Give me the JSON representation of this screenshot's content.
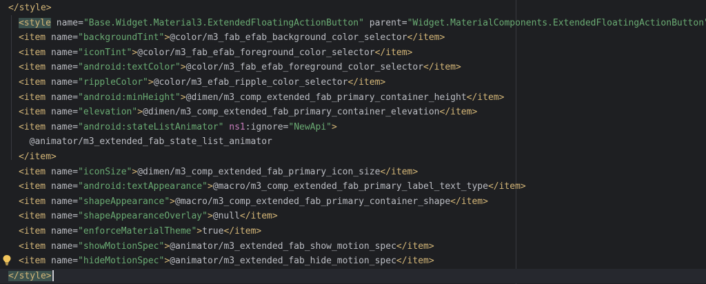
{
  "editor": {
    "lines": [
      {
        "id": "style-close-top",
        "segments": [
          {
            "cls": "tag",
            "text": "</style>"
          }
        ]
      },
      {
        "id": "style-open",
        "segments": [
          {
            "cls": "tag hl",
            "text": "<style"
          },
          {
            "cls": "attr",
            "text": " name="
          },
          {
            "cls": "str",
            "text": "\"Base.Widget.Material3.ExtendedFloatingActionButton\""
          },
          {
            "cls": "attr",
            "text": " parent="
          },
          {
            "cls": "str",
            "text": "\"Widget.MaterialComponents.ExtendedFloatingActionButton\""
          },
          {
            "cls": "tag",
            "text": ">"
          }
        ]
      },
      {
        "id": "item-backgroundTint",
        "segments": [
          {
            "cls": "tag",
            "text": "<item"
          },
          {
            "cls": "attr",
            "text": " name="
          },
          {
            "cls": "str",
            "text": "\"backgroundTint\""
          },
          {
            "cls": "tag",
            "text": ">"
          },
          {
            "cls": "txt",
            "text": "@color/m3_fab_efab_background_color_selector"
          },
          {
            "cls": "tag",
            "text": "</item>"
          }
        ]
      },
      {
        "id": "item-iconTint",
        "segments": [
          {
            "cls": "tag",
            "text": "<item"
          },
          {
            "cls": "attr",
            "text": " name="
          },
          {
            "cls": "str",
            "text": "\"iconTint\""
          },
          {
            "cls": "tag",
            "text": ">"
          },
          {
            "cls": "txt",
            "text": "@color/m3_fab_efab_foreground_color_selector"
          },
          {
            "cls": "tag",
            "text": "</item>"
          }
        ]
      },
      {
        "id": "item-textColor",
        "segments": [
          {
            "cls": "tag",
            "text": "<item"
          },
          {
            "cls": "attr",
            "text": " name="
          },
          {
            "cls": "str",
            "text": "\"android:textColor\""
          },
          {
            "cls": "tag",
            "text": ">"
          },
          {
            "cls": "txt",
            "text": "@color/m3_fab_efab_foreground_color_selector"
          },
          {
            "cls": "tag",
            "text": "</item>"
          }
        ]
      },
      {
        "id": "item-rippleColor",
        "segments": [
          {
            "cls": "tag",
            "text": "<item"
          },
          {
            "cls": "attr",
            "text": " name="
          },
          {
            "cls": "str",
            "text": "\"rippleColor\""
          },
          {
            "cls": "tag",
            "text": ">"
          },
          {
            "cls": "txt",
            "text": "@color/m3_efab_ripple_color_selector"
          },
          {
            "cls": "tag",
            "text": "</item>"
          }
        ]
      },
      {
        "id": "item-minHeight",
        "segments": [
          {
            "cls": "tag",
            "text": "<item"
          },
          {
            "cls": "attr",
            "text": " name="
          },
          {
            "cls": "str",
            "text": "\"android:minHeight\""
          },
          {
            "cls": "tag",
            "text": ">"
          },
          {
            "cls": "txt",
            "text": "@dimen/m3_comp_extended_fab_primary_container_height"
          },
          {
            "cls": "tag",
            "text": "</item>"
          }
        ]
      },
      {
        "id": "item-elevation",
        "segments": [
          {
            "cls": "tag",
            "text": "<item"
          },
          {
            "cls": "attr",
            "text": " name="
          },
          {
            "cls": "str",
            "text": "\"elevation\""
          },
          {
            "cls": "tag",
            "text": ">"
          },
          {
            "cls": "txt",
            "text": "@dimen/m3_comp_extended_fab_primary_container_elevation"
          },
          {
            "cls": "tag",
            "text": "</item>"
          }
        ]
      },
      {
        "id": "item-stateListAnimator",
        "segments": [
          {
            "cls": "tag",
            "text": "<item"
          },
          {
            "cls": "attr",
            "text": " name="
          },
          {
            "cls": "str",
            "text": "\"android:stateListAnimator\""
          },
          {
            "cls": "ns",
            "text": " ns1"
          },
          {
            "cls": "attr",
            "text": ":ignore="
          },
          {
            "cls": "str",
            "text": "\"NewApi\""
          },
          {
            "cls": "tag",
            "text": ">"
          }
        ]
      },
      {
        "id": "animator-value",
        "segments": [
          {
            "cls": "txt",
            "text": "  @animator/m3_extended_fab_state_list_animator"
          }
        ]
      },
      {
        "id": "item-close",
        "segments": [
          {
            "cls": "tag",
            "text": "</item>"
          }
        ]
      },
      {
        "id": "item-iconSize",
        "segments": [
          {
            "cls": "tag",
            "text": "<item"
          },
          {
            "cls": "attr",
            "text": " name="
          },
          {
            "cls": "str",
            "text": "\"iconSize\""
          },
          {
            "cls": "tag",
            "text": ">"
          },
          {
            "cls": "txt",
            "text": "@dimen/m3_comp_extended_fab_primary_icon_size"
          },
          {
            "cls": "tag",
            "text": "</item>"
          }
        ]
      },
      {
        "id": "item-textAppearance",
        "segments": [
          {
            "cls": "tag",
            "text": "<item"
          },
          {
            "cls": "attr",
            "text": " name="
          },
          {
            "cls": "str",
            "text": "\"android:textAppearance\""
          },
          {
            "cls": "tag",
            "text": ">"
          },
          {
            "cls": "txt",
            "text": "@macro/m3_comp_extended_fab_primary_label_text_type"
          },
          {
            "cls": "tag",
            "text": "</item>"
          }
        ]
      },
      {
        "id": "item-shapeAppearance",
        "segments": [
          {
            "cls": "tag",
            "text": "<item"
          },
          {
            "cls": "attr",
            "text": " name="
          },
          {
            "cls": "str",
            "text": "\"shapeAppearance\""
          },
          {
            "cls": "tag",
            "text": ">"
          },
          {
            "cls": "txt",
            "text": "@macro/m3_comp_extended_fab_primary_container_shape"
          },
          {
            "cls": "tag",
            "text": "</item>"
          }
        ]
      },
      {
        "id": "item-shapeAppearanceOverlay",
        "segments": [
          {
            "cls": "tag",
            "text": "<item"
          },
          {
            "cls": "attr",
            "text": " name="
          },
          {
            "cls": "str",
            "text": "\"shapeAppearanceOverlay\""
          },
          {
            "cls": "tag",
            "text": ">"
          },
          {
            "cls": "txt",
            "text": "@null"
          },
          {
            "cls": "tag",
            "text": "</item>"
          }
        ]
      },
      {
        "id": "item-enforceMaterialTheme",
        "segments": [
          {
            "cls": "tag",
            "text": "<item"
          },
          {
            "cls": "attr",
            "text": " name="
          },
          {
            "cls": "str",
            "text": "\"enforceMaterialTheme\""
          },
          {
            "cls": "tag",
            "text": ">"
          },
          {
            "cls": "txt",
            "text": "true"
          },
          {
            "cls": "tag",
            "text": "</item>"
          }
        ]
      },
      {
        "id": "item-showMotionSpec",
        "segments": [
          {
            "cls": "tag",
            "text": "<item"
          },
          {
            "cls": "attr",
            "text": " name="
          },
          {
            "cls": "str",
            "text": "\"showMotionSpec\""
          },
          {
            "cls": "tag",
            "text": ">"
          },
          {
            "cls": "txt",
            "text": "@animator/m3_extended_fab_show_motion_spec"
          },
          {
            "cls": "tag",
            "text": "</item>"
          }
        ]
      },
      {
        "id": "item-hideMotionSpec",
        "segments": [
          {
            "cls": "tag",
            "text": "<item"
          },
          {
            "cls": "attr",
            "text": " name="
          },
          {
            "cls": "str",
            "text": "\"hideMotionSpec\""
          },
          {
            "cls": "tag",
            "text": ">"
          },
          {
            "cls": "txt",
            "text": "@animator/m3_extended_fab_hide_motion_spec"
          },
          {
            "cls": "tag",
            "text": "</item>"
          }
        ]
      },
      {
        "id": "style-close-bottom",
        "current": true,
        "caret": true,
        "segments": [
          {
            "cls": "tag hl",
            "text": "</style>"
          }
        ]
      }
    ],
    "gutter_icon": "lightbulb-icon",
    "colors": {
      "background": "#1e1f22",
      "tag": "#d5b778",
      "string": "#6aab73",
      "text": "#bcbec4",
      "namespace": "#c77dbb",
      "current_line": "#26282e"
    }
  }
}
